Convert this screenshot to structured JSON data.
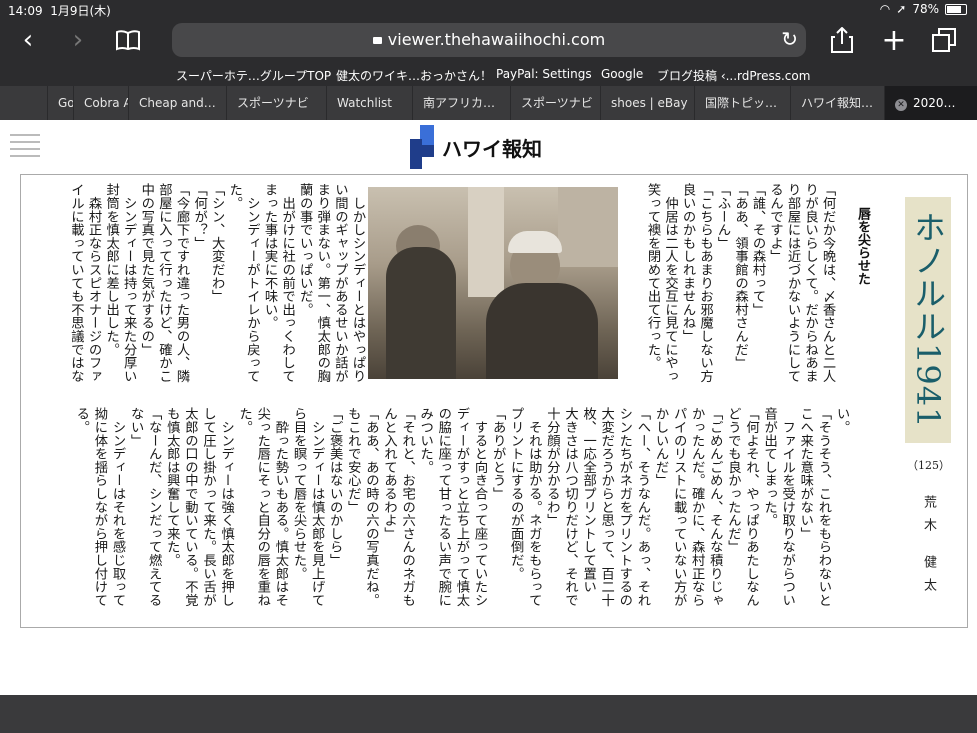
{
  "status_bar": {
    "time": "14:09",
    "date": "1月9日(木)",
    "battery": "78%"
  },
  "toolbar": {
    "url": "viewer.thehawaiihochi.com"
  },
  "bookmarks": [
    "スーパーホテ…グループTOP",
    "健太のワイキ…おっかさん！",
    "PayPal: Settings",
    "Google",
    "ブログ投稿 ‹...rdPress.com"
  ],
  "tabs": [
    "Go",
    "Cobra A",
    "Cheap and…",
    "スポーツナビ",
    "Watchlist",
    "南アフリカ…",
    "スポーツナビ",
    "shoes | eBay",
    "国際トピッ…",
    "ハワイ報知…",
    "2020…"
  ],
  "viewer": {
    "logo_text": "ハワイ報知"
  },
  "article": {
    "series_title": "ホノルル1941",
    "episode": "（125）",
    "author": "荒木 健太",
    "subhead": "唇を尖らせた",
    "cols_top_right": [
      "「何だか今晩は、〆香さんと二人っ",
      "りが良いらしくて。だからねあま",
      "り部屋には近づかないようにして",
      "るんですよ」",
      "「誰、その森村って」",
      "「ああ、領事館の森村さんだ」",
      "「ふーん」",
      "「こちらもあまりお邪魔しない方が",
      "良いのかもしれませんね」",
      "　仲居は二人を交互に見てにやっと",
      "笑って襖を閉めて出て行った。"
    ],
    "cols_top_left": [
      "　しかしシンディーとはやっぱり長",
      "い間のギャップがあるせいか話があ",
      "まり弾まない。第一、慎太郎の胸は",
      "蘭の事でいっぱいだ。",
      "　出がけに社の前で出っくわしてし",
      "まった事は実に不味い。",
      "　シンディーがトイレから戻って来",
      "た。",
      "「シン、大変だわ」",
      "「何が？」",
      "「今廊下ですれ違った男の人、隣の",
      "部屋に入って行ったけど、確かこの",
      "中の写真で見た気がするの」",
      "　シンディーは持って来た分厚い茶",
      "封筒を慎太郎に差し出した。",
      "　森村正ならスピオナージのファ",
      "イルに載っていても不思議ではな"
    ],
    "cols_bottom": [
      "い。",
      "「そうそう、これをもらわないとこ",
      "こへ来た意味がない」",
      "　ファイルを受け取りながらつい本",
      "音が出てしまった。",
      "「何よそれ、やっぱりあたしなんか",
      "どうでも良かったんだ」",
      "「ごめんごめん、そんな積りじゃな",
      "かったんだ。確かに、森村正ならス",
      "パイのリストに載っていない方がお",
      "かしいんだ」",
      "「へー、そうなんだ。あっ、それでね、",
      "シンたちがネガをプリントするのも",
      "大変だろうからと思って、百二十八",
      "枚、一応全部プリントして置いた。",
      "大きさは八つ切りだけど、それでも",
      "十分顔が分かるわ」",
      "　それは助かる。ネガをもらっても",
      "プリントにするのが面倒だ。",
      "「ありがとう」",
      "　すると向き合って座っていたシン",
      "ディーがすっと立ち上がって慎太郎",
      "の脇に座って甘ったるい声で腕に絡",
      "みついた。",
      "「それと、お宅の六さんのネガもちゃ",
      "んと入れてあるわよ」",
      "「ああ、あの時の六の写真だね。六",
      "もこれで安心だ」",
      "「ご褒美はないのかしら」",
      "　シンディーは慎太郎を見上げてか",
      "ら目を瞑って唇を尖らせた。",
      "　酔った勢いもある。慎太郎はその",
      "尖った唇にそっと自分の唇を重ね",
      "た。",
      "　シンディーは強く慎太郎を押し倒",
      "して圧し掛かって来た。長い舌が慎",
      "太郎の口の中で動いている。不覚に",
      "も慎太郎は興奮して来た。",
      "「なーんだ、シンだって燃えてるじゃ",
      "ない」",
      "　シンディーはそれを感じ取って執",
      "拗に体を揺らしながら押し付けて来",
      "る。"
    ]
  }
}
